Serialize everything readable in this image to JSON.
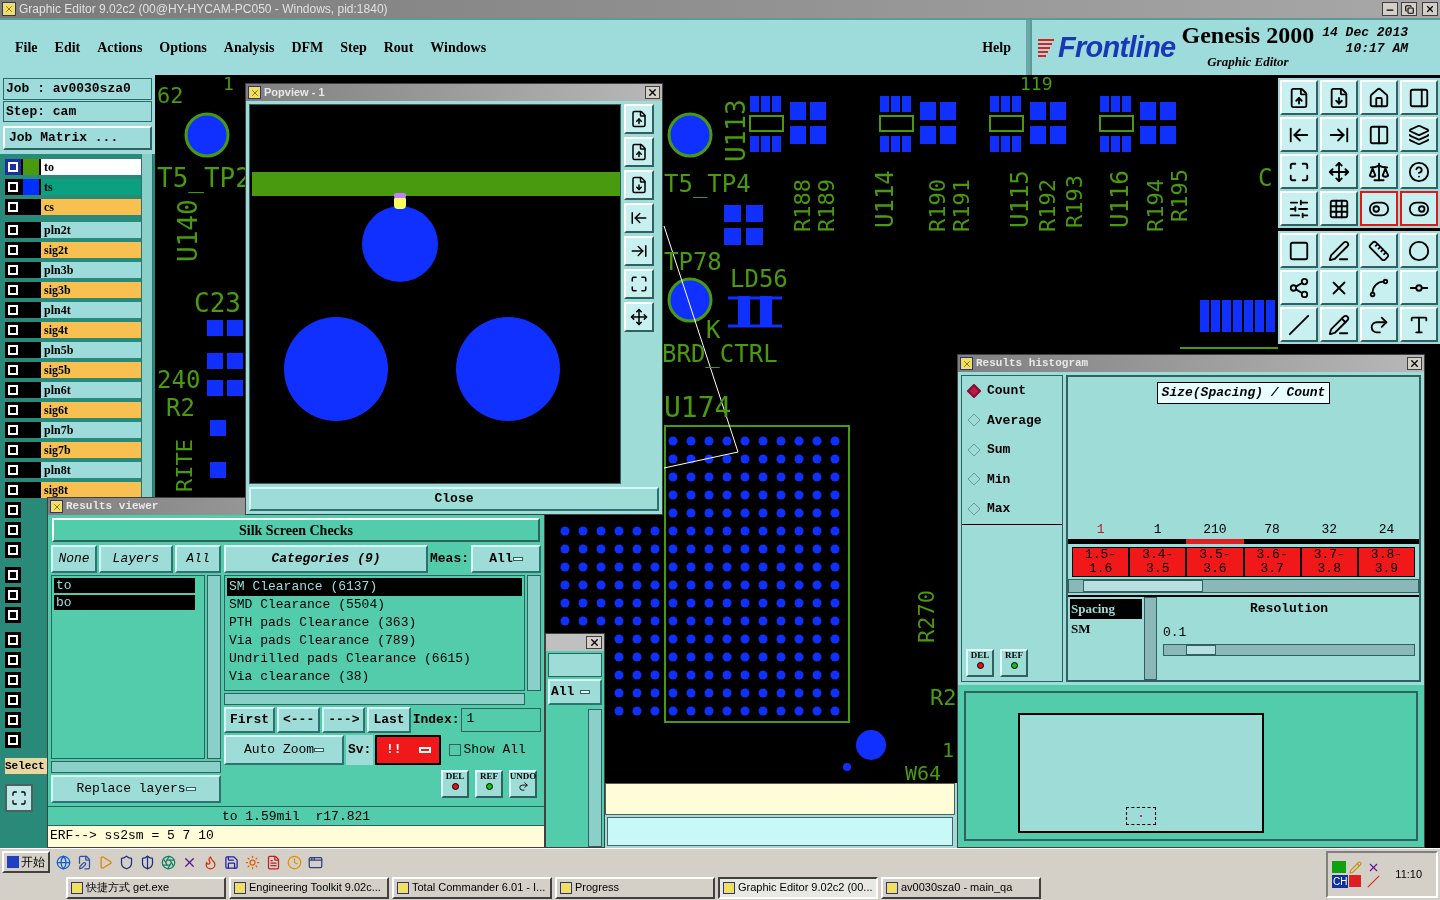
{
  "window": {
    "title": "Graphic Editor 9.02c2 (00@HY-HYCAM-PC050 - Windows, pid:1840)"
  },
  "menu": [
    {
      "label": "File"
    },
    {
      "label": "Edit"
    },
    {
      "label": "Actions"
    },
    {
      "label": "Options"
    },
    {
      "label": "Analysis"
    },
    {
      "label": "DFM"
    },
    {
      "label": "Step"
    },
    {
      "label": "Rout"
    },
    {
      "label": "Windows"
    }
  ],
  "help": "Help",
  "branding": {
    "logo": "Frontline",
    "product": "Genesis 2000",
    "subtitle": "Graphic Editor",
    "date": "14 Dec 2013",
    "time": "10:17 AM"
  },
  "job_panel": {
    "job": "Job : av0030sza0",
    "step": "Step: cam",
    "matrix_button": "Job Matrix ...",
    "select_label": "Select"
  },
  "layers": [
    {
      "name": "to",
      "kind": "work",
      "color": "#ffffff",
      "selected": true
    },
    {
      "name": "ts",
      "kind": "mask",
      "color": "#0aa080",
      "selected": false
    },
    {
      "name": "cs",
      "kind": "signal",
      "color": "#f8c050",
      "selected": false
    },
    {
      "name": "pln2t",
      "kind": "plane",
      "color": "#9edcdc",
      "selected": false
    },
    {
      "name": "sig2t",
      "kind": "signal",
      "color": "#f8c050",
      "selected": false
    },
    {
      "name": "pln3b",
      "kind": "plane",
      "color": "#9edcdc",
      "selected": false
    },
    {
      "name": "sig3b",
      "kind": "signal",
      "color": "#f8c050",
      "selected": false
    },
    {
      "name": "pln4t",
      "kind": "plane",
      "color": "#9edcdc",
      "selected": false
    },
    {
      "name": "sig4t",
      "kind": "signal",
      "color": "#f8c050",
      "selected": false
    },
    {
      "name": "pln5b",
      "kind": "plane",
      "color": "#9edcdc",
      "selected": false
    },
    {
      "name": "sig5b",
      "kind": "signal",
      "color": "#f8c050",
      "selected": false
    },
    {
      "name": "pln6t",
      "kind": "plane",
      "color": "#9edcdc",
      "selected": false
    },
    {
      "name": "sig6t",
      "kind": "signal",
      "color": "#f8c050",
      "selected": false
    },
    {
      "name": "pln7b",
      "kind": "plane",
      "color": "#9edcdc",
      "selected": false
    },
    {
      "name": "sig7b",
      "kind": "signal",
      "color": "#f8c050",
      "selected": false
    },
    {
      "name": "pln8t",
      "kind": "plane",
      "color": "#9edcdc",
      "selected": false
    },
    {
      "name": "sig8t",
      "kind": "signal",
      "color": "#f8c050",
      "selected": false
    }
  ],
  "canvas": {
    "labels": [
      "62",
      "1",
      "U113",
      "119",
      "T5_TP2",
      "U140",
      "T5_TP4",
      "R188",
      "R189",
      "U114",
      "R190",
      "R191",
      "U115",
      "R192",
      "R193",
      "U116",
      "R194",
      "R195",
      "C",
      "TP78",
      "LD56",
      "C23",
      "K",
      "BRD_CTRL",
      "240",
      "R2",
      "U174",
      "RITE",
      "R270",
      "R2",
      "1",
      "W64"
    ]
  },
  "toolbar": {
    "buttons": [
      {
        "active": false
      },
      {
        "active": false
      },
      {
        "active": false
      },
      {
        "active": false
      },
      {
        "active": false
      },
      {
        "active": false
      },
      {
        "active": false
      },
      {
        "active": false
      },
      {
        "active": false
      },
      {
        "active": false
      },
      {
        "active": false
      },
      {
        "active": false
      },
      {
        "active": false
      },
      {
        "active": false
      },
      {
        "active": true
      },
      {
        "active": true
      },
      {
        "active": false
      },
      {
        "active": false
      },
      {
        "active": false
      },
      {
        "active": false
      },
      {
        "active": false
      },
      {
        "active": false
      },
      {
        "active": false
      },
      {
        "active": false
      },
      {
        "active": false
      },
      {
        "active": false
      },
      {
        "active": false
      },
      {
        "active": false
      }
    ]
  },
  "popview": {
    "title": "Popview - 1",
    "close_button": "Close"
  },
  "results_viewer": {
    "title": "Results viewer",
    "heading": "Silk Screen Checks",
    "layer_buttons": [
      "None",
      "Layers",
      "All"
    ],
    "layers": [
      {
        "name": "to",
        "selected": true
      },
      {
        "name": "bo",
        "selected": true
      }
    ],
    "categories_button": "Categories (9)",
    "meas_label": "Meas:",
    "meas_value": "All",
    "categories": [
      {
        "label": "SM Clearance (6137)",
        "selected": true
      },
      {
        "label": "SMD Clearance (5504)",
        "selected": false
      },
      {
        "label": "PTH pads Clearance (363)",
        "selected": false
      },
      {
        "label": "Via pads Clearance (789)",
        "selected": false
      },
      {
        "label": "Undrilled pads Clearance (6615)",
        "selected": false
      },
      {
        "label": "Via clearance (38)",
        "selected": false
      }
    ],
    "nav": [
      "First",
      "<---",
      "--->",
      "Last"
    ],
    "index_label": "Index:",
    "index_value": "1",
    "auto_zoom": "Auto Zoom",
    "sv_label": "Sv:",
    "sv_value": "!!",
    "show_all": {
      "label": "Show All",
      "checked": false
    },
    "replace": "Replace layers",
    "action_buttons": [
      "DEL",
      "REF",
      "UNDO"
    ],
    "status": "to 1.59mil  r17.821",
    "erf": "ERF--> ss2sm = 5 7 10"
  },
  "behind_window": {
    "menu_value": "All"
  },
  "histogram": {
    "title": "Results histogram",
    "modes": [
      {
        "label": "Count",
        "selected": true
      },
      {
        "label": "Average",
        "selected": false
      },
      {
        "label": "Sum",
        "selected": false
      },
      {
        "label": "Min",
        "selected": false
      },
      {
        "label": "Max",
        "selected": false
      }
    ],
    "chart_title": "Size(Spacing) / Count",
    "bins": [
      {
        "count": "1",
        "from": "1.5-",
        "to": "1.6",
        "selected": true,
        "peak": false
      },
      {
        "count": "1",
        "from": "3.4-",
        "to": "3.5",
        "selected": false,
        "peak": false
      },
      {
        "count": "210",
        "from": "3.5-",
        "to": "3.6",
        "selected": false,
        "peak": true
      },
      {
        "count": "78",
        "from": "3.6-",
        "to": "3.7",
        "selected": false,
        "peak": false
      },
      {
        "count": "32",
        "from": "3.7-",
        "to": "3.8",
        "selected": false,
        "peak": false
      },
      {
        "count": "24",
        "from": "3.8-",
        "to": "3.9",
        "selected": false,
        "peak": false
      }
    ],
    "buttons": [
      "DEL",
      "REF"
    ],
    "list": [
      {
        "label": "Spacing",
        "selected": true
      },
      {
        "label": "SM",
        "selected": false
      }
    ],
    "resolution_label": "Resolution",
    "resolution_value": "0.1",
    "resolution_slider": {
      "level": 0.1
    }
  },
  "taskbar": {
    "start": "开始",
    "tasks": [
      {
        "label": "快捷方式 get.exe",
        "selected": false
      },
      {
        "label": "Engineering Toolkit 9.02c...",
        "selected": false
      },
      {
        "label": "Total Commander 6.01 - I...",
        "selected": false
      },
      {
        "label": "Progress",
        "selected": false
      },
      {
        "label": "Graphic Editor 9.02c2 (00...",
        "selected": true
      },
      {
        "label": "av0030sza0 - main_qa",
        "selected": false
      }
    ],
    "tray": {
      "language": "CH",
      "time": "11:10"
    }
  }
}
